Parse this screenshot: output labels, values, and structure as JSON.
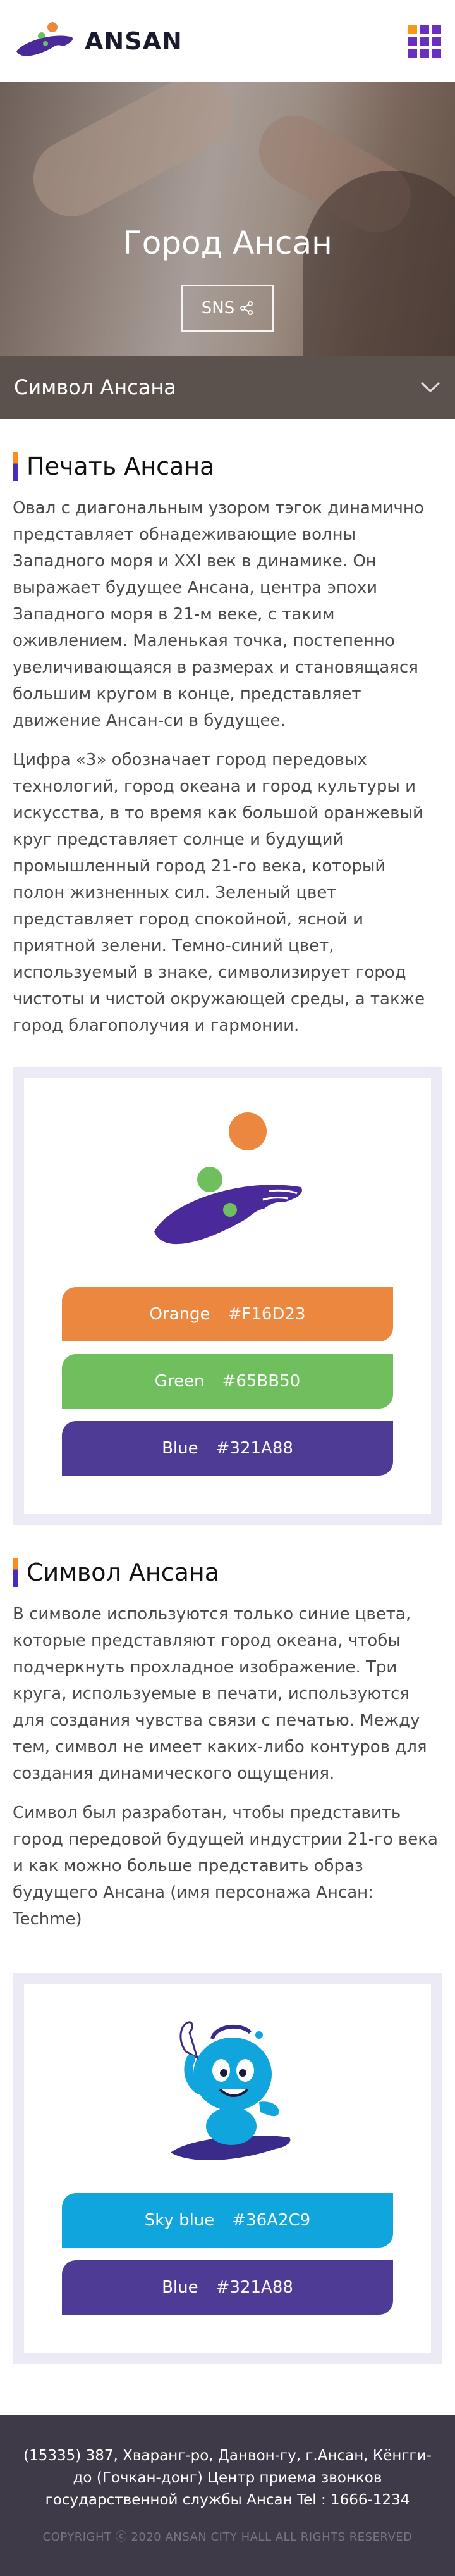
{
  "header": {
    "logo_text": "ANSAN",
    "menu_icon": "grid-menu-icon",
    "colors": {
      "brand_purple": "#6a2fc0",
      "brand_orange": "#f39a1a"
    }
  },
  "hero": {
    "title": "Город Ансан",
    "sns_label": "SNS",
    "sns_icon": "share-icon",
    "sub_nav_label": "Символ Ансана",
    "sub_nav_icon": "chevron-down-icon"
  },
  "seal_section": {
    "title": "Печать Ансана",
    "paragraphs": [
      "Овал с диагональным узором тэгок динамично представляет обнадеживающие волны Западного моря и XXI век в динамике. Он выражает будущее Ансана, центра эпохи Западного моря в 21-м веке, с таким оживлением. Маленькая точка, постепенно увеличивающаяся в размерах и становящаяся большим кругом в конце, представляет движение Ансан-си в будущее.",
      "Цифра «3» обозначает город передовых технологий, город океана и город культуры и искусства, в то время как большой оранжевый круг представляет солнце и будущий промышленный город 21-го века, который полон жизненных сил. Зеленый цвет представляет город спокойной, ясной и приятной зелени. Темно-синий цвет, используемый в знаке, символизирует город чистоты и чистой окружающей среды, а также город благополучия и гармонии."
    ],
    "swatches": [
      {
        "name": "Orange",
        "hex": "#F16D23",
        "color": "#ec8740"
      },
      {
        "name": "Green",
        "hex": "#65BB50",
        "color": "#6fbf5f"
      },
      {
        "name": "Blue",
        "hex": "#321A88",
        "color": "#4e3b95"
      }
    ]
  },
  "symbol_section": {
    "title": "Символ Ансана",
    "paragraphs": [
      "В символе используются только синие цвета, которые представляют город океана, чтобы подчеркнуть прохладное изображение. Три круга, используемые в печати, используются для создания чувства связи с печатью. Между тем, символ не имеет каких-либо контуров для создания динамического ощущения.",
      "Символ был разработан, чтобы представить город передовой будущей индустрии 21-го века и как можно больше представить образ будущего Ансана (имя персонажа Ансан: Techme)"
    ],
    "swatches": [
      {
        "name": "Sky blue",
        "hex": "#36A2C9",
        "color": "#10a5dd"
      },
      {
        "name": "Blue",
        "hex": "#321A88",
        "color": "#4e3b95"
      }
    ]
  },
  "footer": {
    "address": "(15335) 387, Хваранг-ро, Данвон-гу, г.Ансан, Кёнгги-до (Гочкан-донг) Центр приема звонков государственной службы Ансан    Tel : 1666-1234",
    "copyright": "COPYRIGHT ⓒ 2020 ANSAN CITY HALL ALL RIGHTS RESERVED"
  }
}
